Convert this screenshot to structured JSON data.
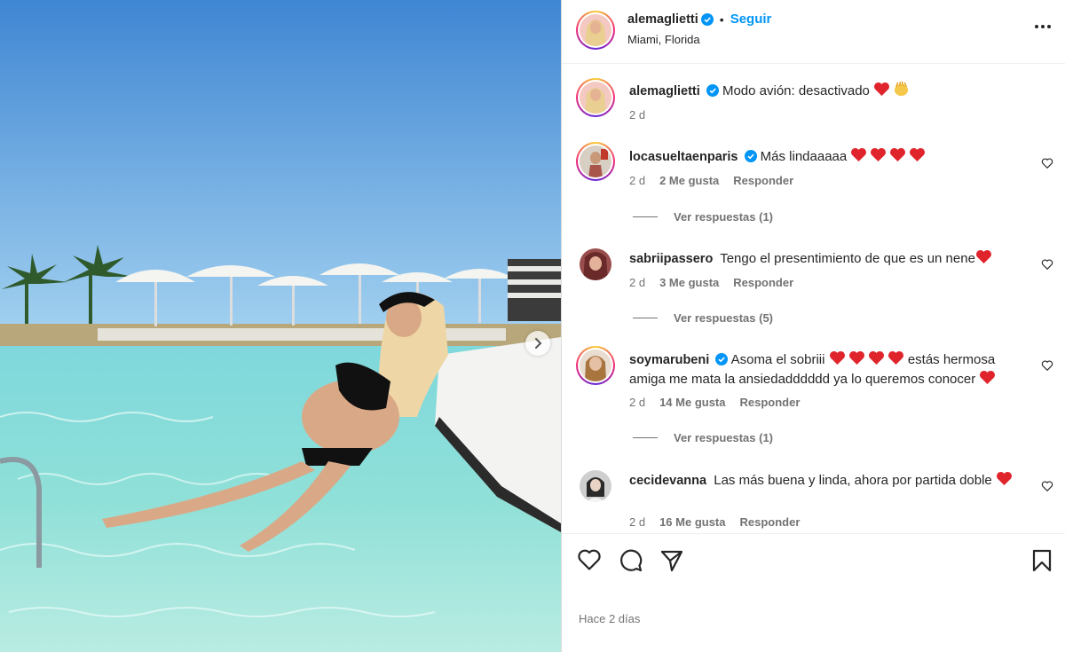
{
  "post": {
    "author": "alemaglietti",
    "follow_label": "Seguir",
    "separator": "•",
    "location": "Miami, Florida",
    "time_ago": "Hace 2 días"
  },
  "caption": {
    "user": "alemaglietti",
    "text": "Modo avión: desactivado",
    "time": "2 d"
  },
  "comments": [
    {
      "user": "locasueltaenparis",
      "text": "Más lindaaaaa",
      "time": "2 d",
      "likes": "2 Me gusta",
      "reply": "Responder",
      "view_replies": "Ver respuestas (1)"
    },
    {
      "user": "sabriipassero",
      "text": "Tengo el presentimiento de que es un nene",
      "time": "2 d",
      "likes": "3 Me gusta",
      "reply": "Responder",
      "view_replies": "Ver respuestas (5)"
    },
    {
      "user": "soymarubeni",
      "text_a": "Asoma el sobriii",
      "text_b": "estás hermosa",
      "text_c": "amiga me mata la ansiedadddddd ya lo queremos conocer",
      "time": "2 d",
      "likes": "14 Me gusta",
      "reply": "Responder",
      "view_replies": "Ver respuestas (1)"
    },
    {
      "user": "cecidevanna",
      "text": "Las más buena y linda, ahora por partida doble",
      "time": "2 d",
      "likes": "16 Me gusta",
      "reply": "Responder"
    }
  ],
  "colors": {
    "follow_blue": "#0095f6",
    "verified_blue": "#0095f6",
    "heart_red": "#e0242b",
    "muted_text": "#737373"
  },
  "icons": [
    "verified-badge-icon",
    "more-options-icon",
    "heart-outline-icon",
    "comment-bubble-icon",
    "share-send-icon",
    "bookmark-icon",
    "chevron-right-icon",
    "red-heart-emoji",
    "raising-hands-emoji"
  ]
}
